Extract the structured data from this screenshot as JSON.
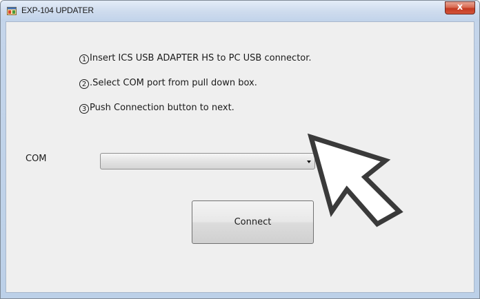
{
  "window": {
    "title": "EXP-104 UPDATER",
    "close_label": "x",
    "icon": "app-window-icon"
  },
  "instructions": [
    {
      "num": "1",
      "text": "Insert ICS USB ADAPTER HS to PC USB connector."
    },
    {
      "num": "2",
      "text": ".Select COM port from pull down box."
    },
    {
      "num": "3",
      "text": "Push Connection button to next."
    }
  ],
  "com": {
    "label": "COM",
    "selected_value": ""
  },
  "connect_button": {
    "label": "Connect"
  },
  "colors": {
    "title_gradient_top": "#e4edf8",
    "client_background": "#efefef",
    "close_button": "#c43a22",
    "cursor_fill": "#ffffff",
    "cursor_stroke": "#3a3a3a"
  }
}
